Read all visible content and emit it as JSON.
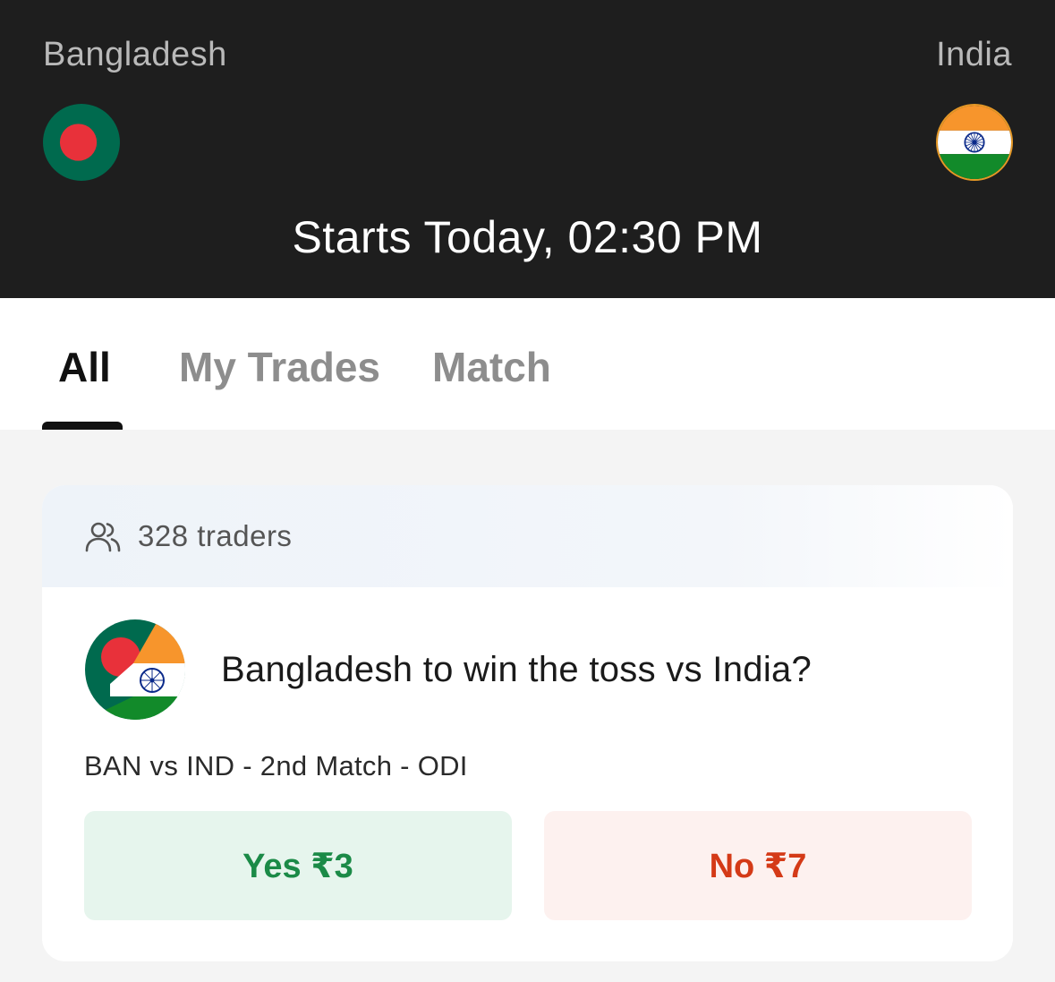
{
  "header": {
    "team_left": "Bangladesh",
    "team_right": "India",
    "start_time": "Starts Today, 02:30 PM"
  },
  "tabs": [
    {
      "label": "All",
      "active": true
    },
    {
      "label": "My Trades",
      "active": false
    },
    {
      "label": "Match",
      "active": false
    }
  ],
  "card": {
    "traders": "328 traders",
    "question": "Bangladesh to win the toss vs India?",
    "subtitle": "BAN vs IND - 2nd Match - ODI",
    "yes_label": "Yes ₹3",
    "no_label": "No ₹7"
  },
  "colors": {
    "header_bg": "#1e1e1e",
    "yes_bg": "#e6f5ed",
    "yes_text": "#1b8a47",
    "no_bg": "#fdf1ef",
    "no_text": "#d43a17",
    "bangladesh_green": "#006a4e",
    "bangladesh_red": "#e8313a",
    "india_saffron": "#f7952c",
    "india_green": "#128a2a",
    "india_chakra": "#0b2a8a"
  },
  "icons": {
    "traders": "users-icon",
    "team_left_flag": "bangladesh-flag-icon",
    "team_right_flag": "india-flag-icon",
    "market_flag": "bangladesh-india-combined-flag-icon"
  }
}
